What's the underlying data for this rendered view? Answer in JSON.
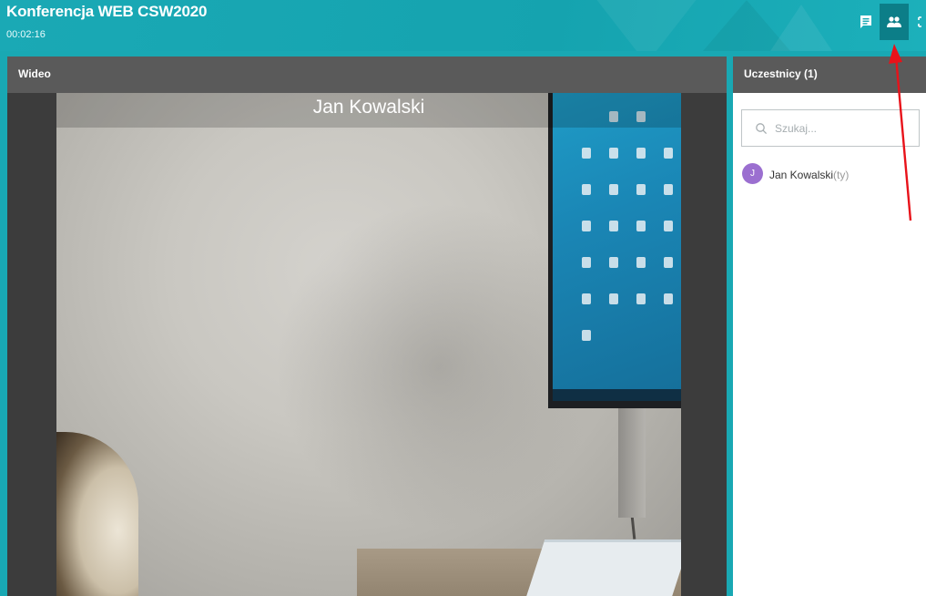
{
  "header": {
    "title": "Konferencja WEB CSW2020",
    "timer": "00:02:16",
    "buttons": {
      "chat": "chat-icon",
      "participants": "people-icon",
      "fullscreen": "fullscreen-icon"
    },
    "color": "#19a8b3"
  },
  "video": {
    "panel_title": "Wideo",
    "participant_name": "Jan Kowalski"
  },
  "participants": {
    "panel_title": "Uczestnicy (1)",
    "search_placeholder": "Szukaj...",
    "list": [
      {
        "initial": "J",
        "name": "Jan Kowalski",
        "suffix": "(ty)",
        "avatar_color": "#9b6fd0"
      }
    ]
  },
  "annotation": {
    "arrow_color": "#e8121a"
  }
}
